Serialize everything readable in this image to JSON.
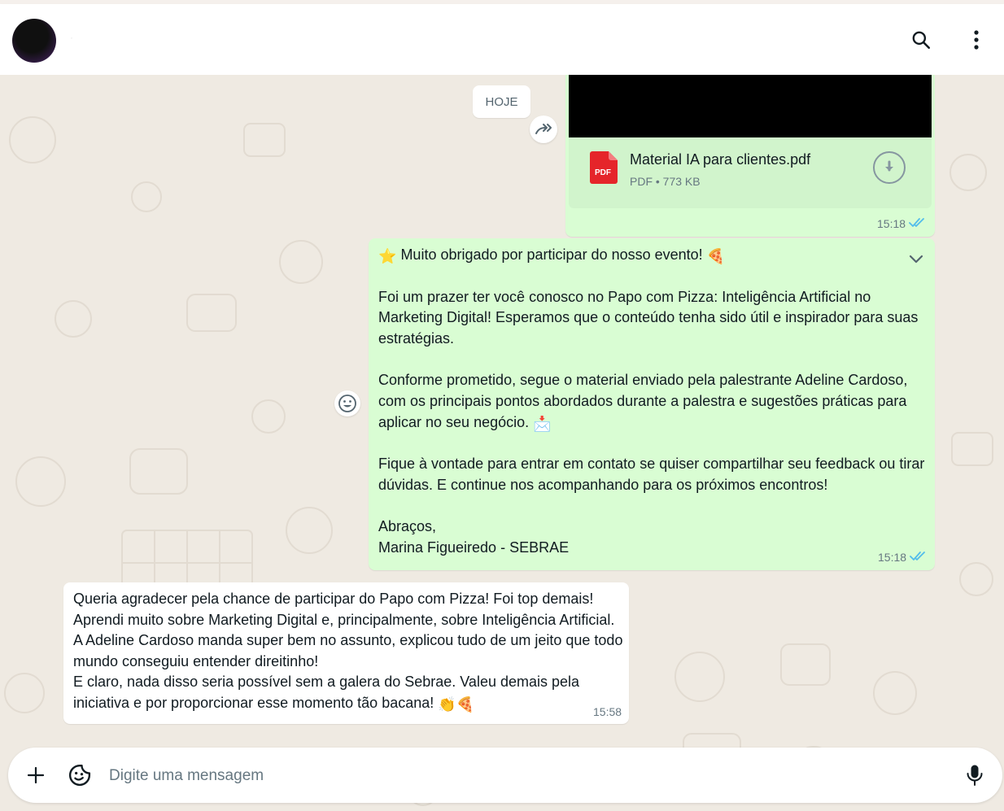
{
  "header": {
    "contact_name": "·"
  },
  "chat": {
    "date_separator": "HOJE",
    "document_message": {
      "file_name": "Material IA para clientes.pdf",
      "file_type": "PDF",
      "file_size": "773 KB",
      "meta": "PDF • 773 KB",
      "time": "15:18",
      "pdf_badge": "PDF"
    },
    "outgoing_message": {
      "paragraphs": [
        "Muito obrigado por participar do nosso evento!",
        "Foi um prazer ter você conosco no Papo com Pizza: Inteligência Artificial no Marketing Digital! Esperamos que o conteúdo tenha sido útil e inspirador para suas estratégias.",
        "Conforme prometido, segue o material enviado pela palestrante Adeline Cardoso, com os principais pontos abordados durante a palestra e sugestões práticas para aplicar no seu negócio.",
        "Fique à vontade para entrar em contato se quiser compartilhar seu feedback ou tirar dúvidas. E continue nos acompanhando para os próximos encontros!",
        "Abraços,",
        "Marina Figueiredo - SEBRAE"
      ],
      "time": "15:18",
      "emojis": {
        "star": "⭐",
        "pizza": "🍕",
        "envelope": "📩"
      }
    },
    "incoming_message": {
      "lines": [
        "Queria agradecer pela chance de participar do Papo com Pizza! Foi top demais! Aprendi muito sobre Marketing Digital e, principalmente, sobre Inteligência Artificial. A Adeline Cardoso manda super bem no assunto, explicou tudo de um jeito que todo mundo conseguiu entender direitinho!",
        "E claro, nada disso seria possível sem a galera do Sebrae. Valeu demais pela iniciativa e por proporcionar esse momento tão bacana!"
      ],
      "emojis": "👏🍕",
      "time": "15:58"
    }
  },
  "compose": {
    "placeholder": "Digite uma mensagem"
  },
  "colors": {
    "outgoing_bubble": "#d9fdd3",
    "incoming_bubble": "#ffffff",
    "chat_background": "#efeae2",
    "read_ticks": "#53bdeb",
    "pdf_red": "#e5252a"
  },
  "icons": {
    "header": [
      "search-icon",
      "menu-dots-icon"
    ],
    "chat": [
      "forward-icon",
      "emoji-reaction-icon",
      "download-icon",
      "chevron-down-icon",
      "double-check-icon",
      "pdf-file-icon"
    ],
    "compose": [
      "plus-icon",
      "sticker-icon",
      "microphone-icon"
    ]
  }
}
